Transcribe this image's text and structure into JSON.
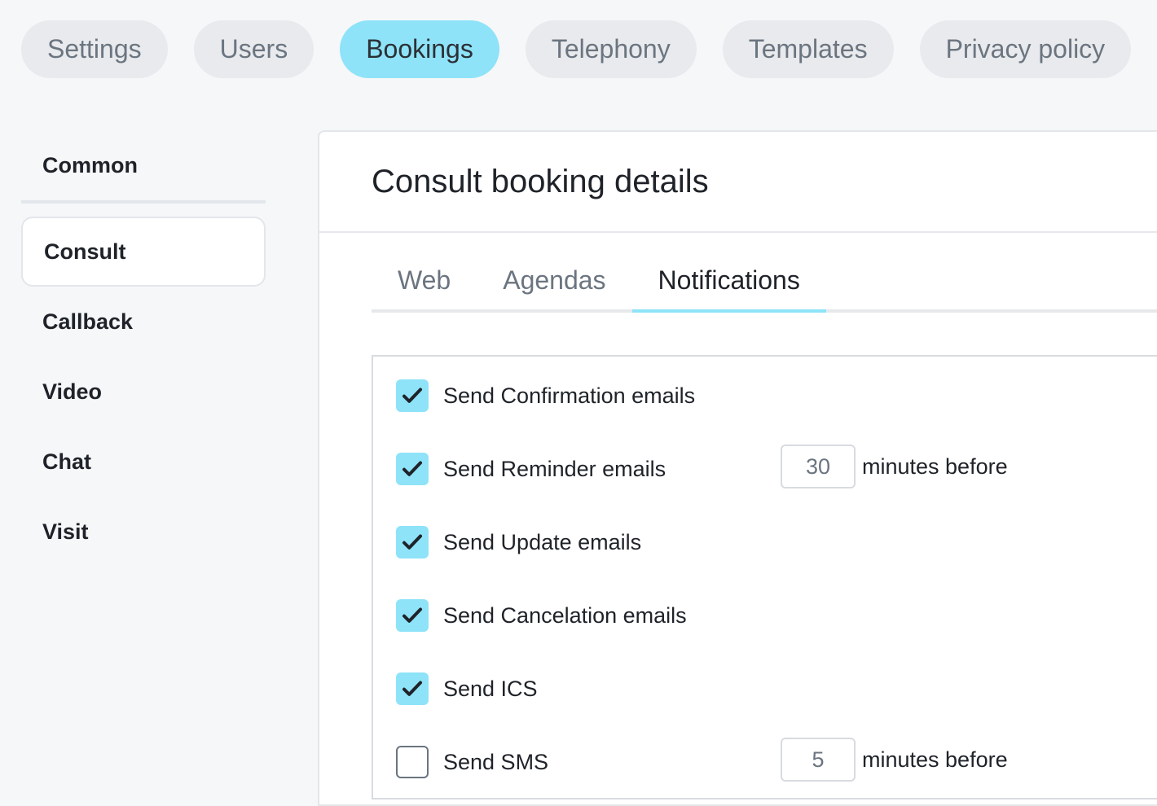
{
  "top_tabs": [
    "Settings",
    "Users",
    "Bookings",
    "Telephony",
    "Templates",
    "Privacy policy"
  ],
  "top_tabs_active": "Bookings",
  "side_nav": {
    "common": "Common",
    "items": [
      "Consult",
      "Callback",
      "Video",
      "Chat",
      "Visit"
    ],
    "active": "Consult"
  },
  "panel": {
    "title": "Consult booking details",
    "tabs": [
      "Web",
      "Agendas",
      "Notifications"
    ],
    "active_tab": "Notifications"
  },
  "notifications": [
    {
      "label": "Send Confirmation emails",
      "checked": true
    },
    {
      "label": "Send Reminder emails",
      "checked": true,
      "minutes": "30",
      "minutes_label": "minutes before"
    },
    {
      "label": "Send Update emails",
      "checked": true
    },
    {
      "label": "Send Cancelation emails",
      "checked": true
    },
    {
      "label": "Send ICS",
      "checked": true
    },
    {
      "label": "Send SMS",
      "checked": false,
      "minutes": "5",
      "minutes_label": "minutes before"
    }
  ],
  "colors": {
    "accent": "#8ee3f8",
    "background": "#f6f7f9",
    "text": "#1f2329",
    "muted": "#6b7580"
  },
  "icons": {
    "checkbox_checked": "checkmark-icon"
  }
}
